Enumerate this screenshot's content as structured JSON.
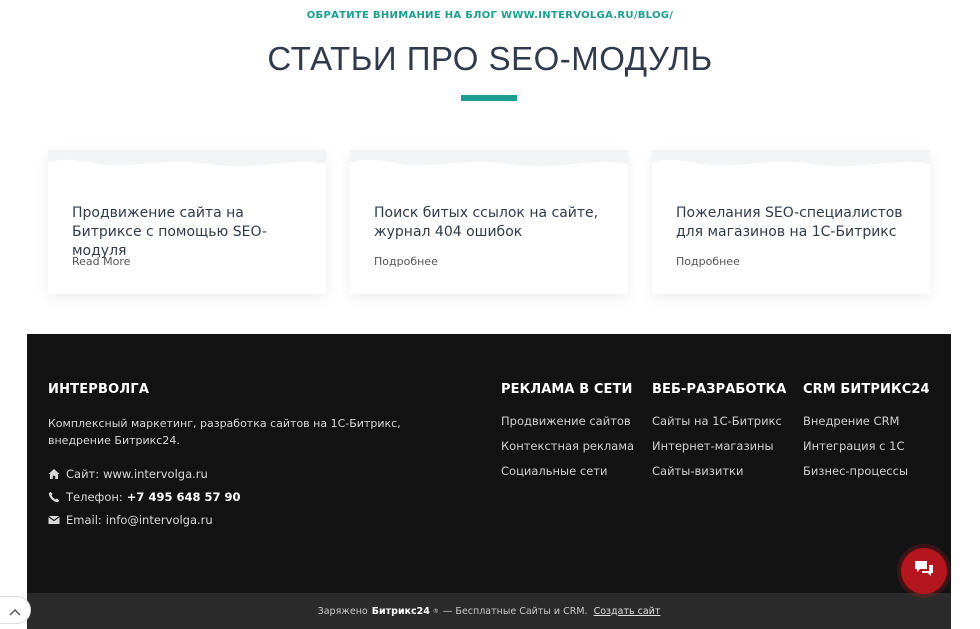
{
  "header": {
    "kicker": "ОБРАТИТЕ ВНИМАНИЕ НА БЛОГ WWW.INTERVOLGA.RU/BLOG/",
    "title": "СТАТЬИ ПРО SEO-МОДУЛЬ"
  },
  "cards": [
    {
      "title": "Продвижение сайта на Битриксе с помощью SEO-модуля",
      "link": "Read More"
    },
    {
      "title": "Поиск битых ссылок на сайте, журнал 404 ошибок",
      "link": "Подробнее"
    },
    {
      "title": "Пожелания SEO-специалистов для магазинов на 1С-Битрикс",
      "link": "Подробнее"
    }
  ],
  "footer": {
    "brand": "ИНТЕРВОЛГА",
    "description": "Комплексный маркетинг, разработка сайтов на 1С-Битрикс, внедрение Битрикс24.",
    "site_label": "Сайт:",
    "site_value": "www.intervolga.ru",
    "phone_label": "Телефон:",
    "phone_value": "+7 495 648 57 90",
    "email_label": "Email:",
    "email_value": "info@intervolga.ru",
    "columns": [
      {
        "heading": "РЕКЛАМА В СЕТИ",
        "links": [
          "Продвижение сайтов",
          "Контекстная реклама",
          "Социальные сети"
        ]
      },
      {
        "heading": "ВЕБ-РАЗРАБОТКА",
        "links": [
          "Сайты на 1С-Битрикс",
          "Интернет-магазины",
          "Сайты-визитки"
        ]
      },
      {
        "heading": "CRM БИТРИКС24",
        "links": [
          "Внедрение CRM",
          "Интеграция с 1С",
          "Бизнес-процессы"
        ]
      }
    ]
  },
  "bottom_bar": {
    "prefix": "Заряжено",
    "brand": "Битрикс24",
    "mark": "®",
    "middle": "— Бесплатные Сайты и CRM.",
    "create": "Создать сайт"
  },
  "colors": {
    "accent": "#1a9e8f",
    "footer_bg": "#141314",
    "chat_button": "#b3161c"
  },
  "icons": {
    "site": "home-icon",
    "phone": "phone-icon",
    "email": "envelope-icon",
    "chat": "chat-icon",
    "scroll": "chevron-up-icon"
  }
}
